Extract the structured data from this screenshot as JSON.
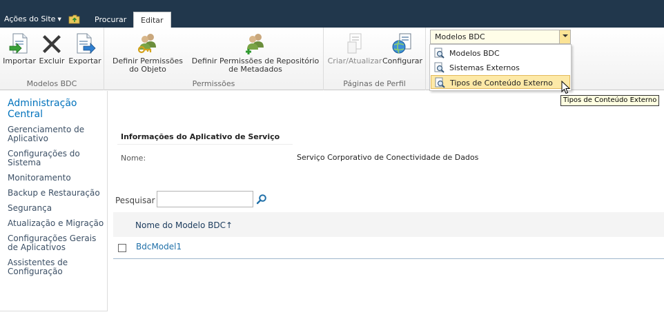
{
  "topbar": {
    "site_actions": "Ações do Site",
    "tabs": [
      {
        "label": "Procurar"
      },
      {
        "label": "Editar"
      }
    ]
  },
  "ribbon": {
    "groups": [
      {
        "label": "Modelos BDC",
        "buttons": [
          {
            "label": "Importar",
            "icon": "import-icon"
          },
          {
            "label": "Excluir",
            "icon": "delete-x-icon"
          },
          {
            "label": "Exportar",
            "icon": "export-icon"
          }
        ]
      },
      {
        "label": "Permissões",
        "buttons": [
          {
            "label": "Definir Permissões do Objeto",
            "icon": "users-key-icon"
          },
          {
            "label": "Definir Permissões de Repositório de Metadados",
            "icon": "users-add-icon"
          }
        ]
      },
      {
        "label": "Páginas de Perfil",
        "buttons": [
          {
            "label": "Criar/Atualizar",
            "icon": "create-update-icon",
            "disabled": true
          },
          {
            "label": "Configurar",
            "icon": "configure-globe-icon"
          }
        ]
      }
    ],
    "view_dropdown": {
      "selected": "Modelos BDC",
      "options": [
        {
          "label": "Modelos BDC",
          "icon": "magnifier-doc-icon"
        },
        {
          "label": "Sistemas Externos",
          "icon": "magnifier-doc-icon"
        },
        {
          "label": "Tipos de Conteúdo Externo",
          "icon": "magnifier-doc-icon",
          "hovered": true
        }
      ],
      "tooltip": "Tipos de Conteúdo Externo"
    }
  },
  "leftnav": {
    "title": "Administração Central",
    "items": [
      "Gerenciamento de Aplicativo",
      "Configurações do Sistema",
      "Monitoramento",
      "Backup e Restauração",
      "Segurança",
      "Atualização e Migração",
      "Configurações Gerais de Aplicativos",
      "Assistentes de Configuração"
    ]
  },
  "main": {
    "section_title": "Informações do Aplicativo de Serviço",
    "name_label": "Nome:",
    "name_value": "Serviço Corporativo de Conectividade de Dados",
    "search_label": "Pesquisar",
    "search_value": "",
    "column_header": "Nome do Modelo BDC",
    "sort_indicator": "↑",
    "rows": [
      {
        "name": "BdcModel1"
      }
    ]
  },
  "colors": {
    "topbar": "#21374c",
    "link": "#1f6fa8",
    "nav_title": "#0072bc",
    "hover": "#fde9a7"
  }
}
